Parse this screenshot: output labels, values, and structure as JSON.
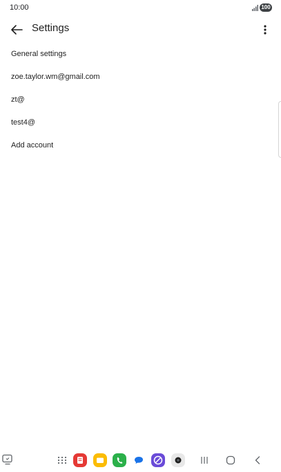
{
  "status_bar": {
    "time": "10:00",
    "battery": "100"
  },
  "header": {
    "title": "Settings"
  },
  "settings_items": [
    {
      "label": "General settings"
    },
    {
      "label": "zoe.taylor.wm@gmail.com"
    },
    {
      "label": "zt@"
    },
    {
      "label": "test4@"
    },
    {
      "label": "Add account"
    }
  ],
  "nav_bar": {
    "icons": [
      "edge-panel-icon",
      "apps-grid-icon",
      "notes-app-icon",
      "files-app-icon",
      "phone-app-icon",
      "messages-app-icon",
      "browser-app-icon",
      "camera-app-icon",
      "recents-icon",
      "home-icon",
      "back-nav-icon"
    ]
  },
  "colors": {
    "notes": "#e53935",
    "files": "#fbbc04",
    "phone": "#2bb04a",
    "messages": "#1a73e8",
    "browser": "#6a4bd8",
    "camera": "#e8e8e8",
    "text": "#1f1f1f"
  }
}
